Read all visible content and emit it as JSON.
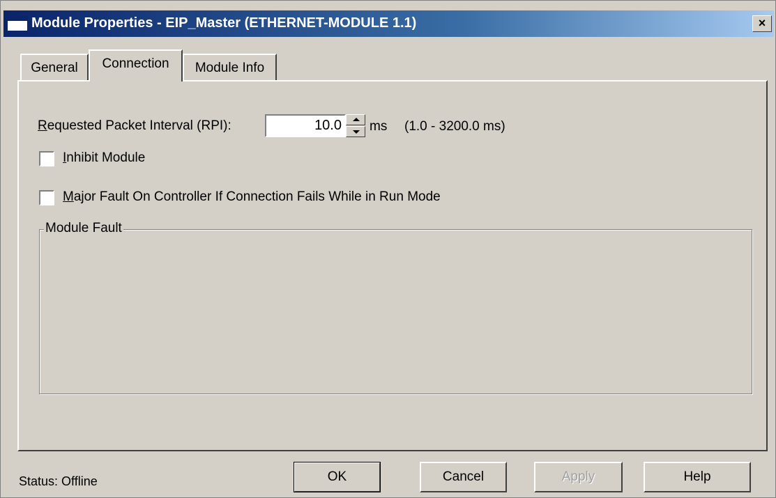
{
  "window": {
    "title": "Module Properties  - EIP_Master (ETHERNET-MODULE 1.1)",
    "close_label": "×"
  },
  "tabs": [
    {
      "label": "General",
      "active": false
    },
    {
      "label": "Connection",
      "active": true
    },
    {
      "label": "Module Info",
      "active": false
    }
  ],
  "connection": {
    "rpi_prefix": "R",
    "rpi_label_rest": "equested Packet Interval (RPI):",
    "rpi_value": "10.0",
    "rpi_unit": "ms",
    "rpi_range": "(1.0 - 3200.0 ms)",
    "inhibit": {
      "prefix": "I",
      "rest": "nhibit Module",
      "checked": false
    },
    "major_fault": {
      "prefix": "M",
      "rest": "ajor Fault On Controller If Connection Fails While in Run Mode",
      "checked": false
    },
    "module_fault_title": "Module Fault"
  },
  "status": {
    "text": "Status:  Offline"
  },
  "buttons": {
    "ok": "OK",
    "cancel": "Cancel",
    "apply": "Apply",
    "help": "Help"
  },
  "icons": {
    "close": "close-icon",
    "spin_up": "spin-up-icon",
    "spin_down": "spin-down-icon",
    "app": "window-icon"
  },
  "colors": {
    "titlebar_start": "#0a246a",
    "titlebar_end": "#a6caf0",
    "face": "#d4d0c8"
  }
}
